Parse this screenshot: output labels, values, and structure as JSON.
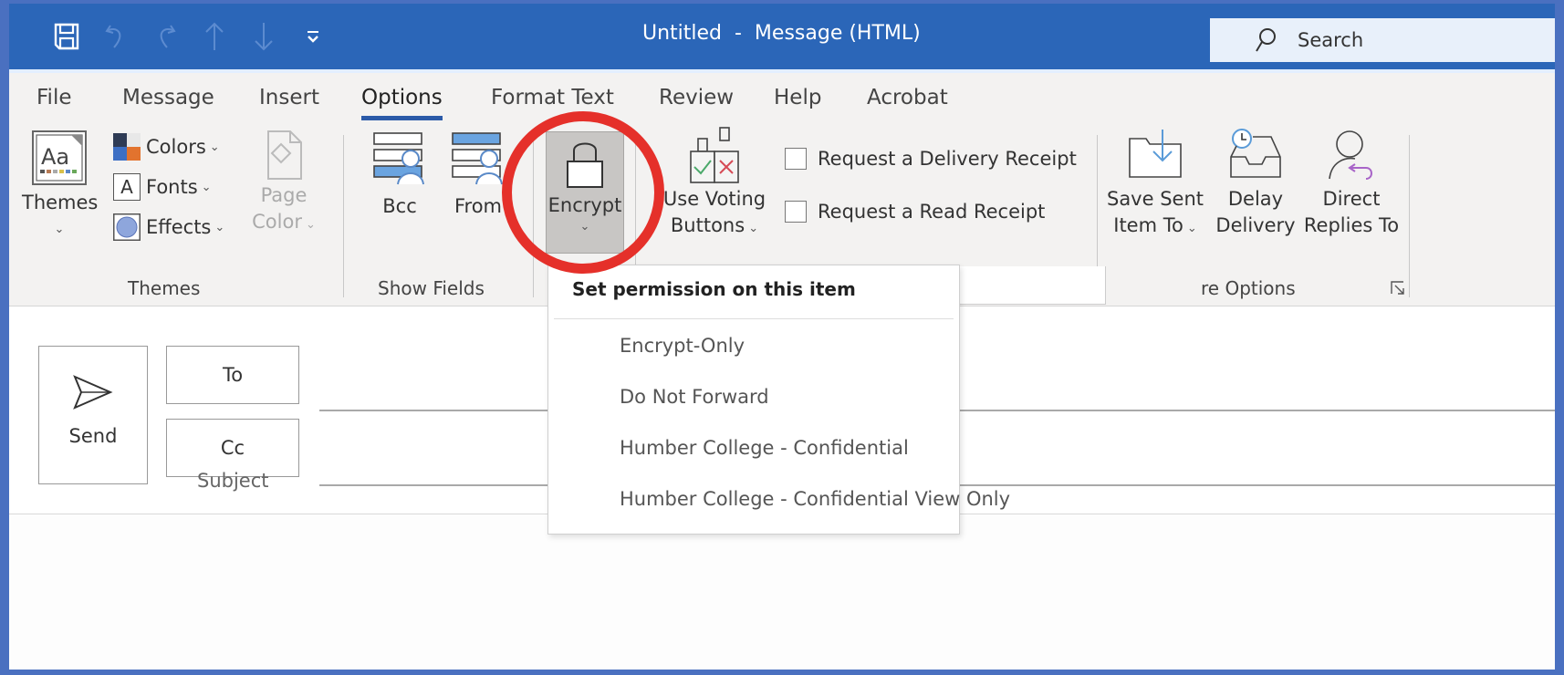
{
  "window": {
    "title": "Untitled  -  Message (HTML)",
    "quick_access": [
      "save-icon",
      "undo-icon",
      "redo-icon",
      "previous-item-icon",
      "next-item-icon",
      "customize-toolbar-icon"
    ],
    "search": {
      "icon": "search-icon",
      "label": "Search"
    }
  },
  "tabs": [
    {
      "label": "File",
      "active": false
    },
    {
      "label": "Message",
      "active": false
    },
    {
      "label": "Insert",
      "active": false
    },
    {
      "label": "Options",
      "active": true
    },
    {
      "label": "Format Text",
      "active": false
    },
    {
      "label": "Review",
      "active": false
    },
    {
      "label": "Help",
      "active": false
    },
    {
      "label": "Acrobat",
      "active": false
    }
  ],
  "ribbon": {
    "themes_group": {
      "label": "Themes",
      "themes_button": "Themes",
      "colors": "Colors",
      "fonts": "Fonts",
      "effects": "Effects",
      "page_color_line1": "Page",
      "page_color_line2": "Color"
    },
    "show_fields_group": {
      "label": "Show Fields",
      "bcc": "Bcc",
      "from": "From"
    },
    "encrypt": {
      "label": "Encrypt"
    },
    "tracking": {
      "voting_line1": "Use Voting",
      "voting_line2": "Buttons",
      "delivery_receipt": {
        "label": "Request a Delivery Receipt",
        "checked": false
      },
      "read_receipt": {
        "label": "Request a Read Receipt",
        "checked": false
      }
    },
    "more_options_group": {
      "label": "More Options",
      "label_visible": "re Options",
      "save_sent_line1": "Save Sent",
      "save_sent_line2": "Item To",
      "delay_line1": "Delay",
      "delay_line2": "Delivery",
      "direct_line1": "Direct",
      "direct_line2": "Replies To"
    }
  },
  "encrypt_dropdown": {
    "header": "Set permission on this item",
    "items": [
      "Encrypt-Only",
      "Do Not Forward",
      "Humber College - Confidential",
      "Humber College - Confidential View Only"
    ]
  },
  "compose": {
    "send": "Send",
    "to": "To",
    "cc": "Cc",
    "subject": "Subject",
    "to_value": "",
    "cc_value": "",
    "subject_value": ""
  },
  "colors": {
    "title_bar": "#2b66b8",
    "frame": "#4a70c0",
    "highlight_ring": "#e5302a",
    "active_tab_underline": "#2b5aa8"
  }
}
